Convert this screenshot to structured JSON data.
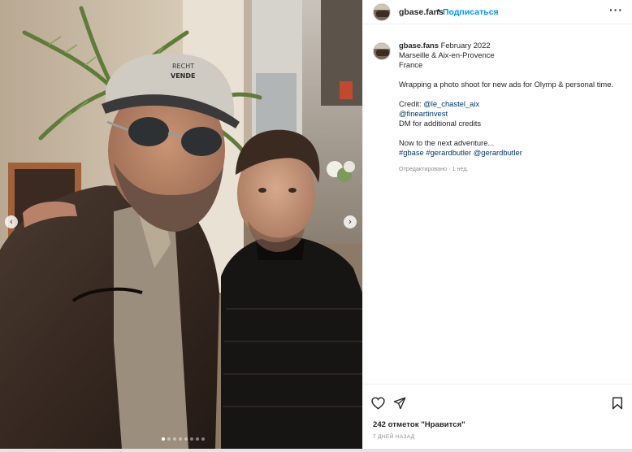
{
  "post": {
    "author": "gbase.fans",
    "follow_label": "Подписаться",
    "separator": "•",
    "more_label": "···"
  },
  "caption": {
    "username": "gbase.fans",
    "date": "February 2022",
    "location_line1": "Marseille & Aix-en-Provence",
    "location_line2": "France",
    "body": "Wrapping a photo shoot for new ads for Olymp & personal time.",
    "credit_prefix": "Credit:",
    "mention1": "@le_chastel_aix",
    "mention2": "@fineartinvest",
    "dm_line": "DM for additional credits",
    "next_line": "Now to the next adventure...",
    "tag1": "#gbase",
    "tag2": "#gerardbutler",
    "tag3": "@gerardbutler",
    "edited": "Отредактировано · 1 нед."
  },
  "actions": {
    "likes": "242 отметок \"Нравится\"",
    "time_ago": "7 ДНЕЙ НАЗАД"
  },
  "carousel": {
    "prev_glyph": "‹",
    "next_glyph": "›",
    "slide_count": 8,
    "active_index": 0
  },
  "photo": {
    "cap_text_top": "RECHT",
    "cap_text_bottom": "VENDE"
  },
  "colors": {
    "link": "#00376b",
    "follow": "#0095f6",
    "muted": "#8e8e8e"
  }
}
